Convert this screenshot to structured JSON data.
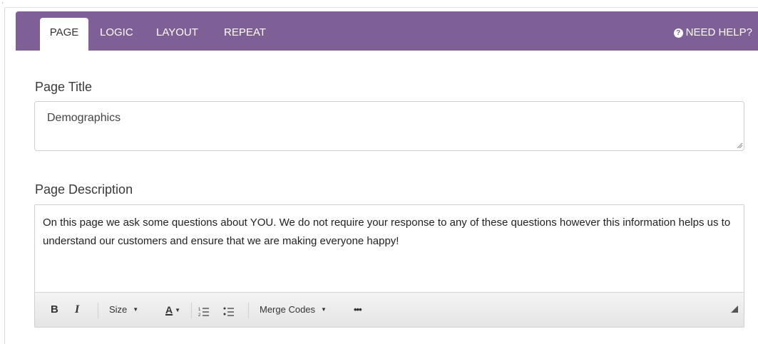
{
  "tabs": [
    {
      "label": "PAGE",
      "active": true
    },
    {
      "label": "LOGIC",
      "active": false
    },
    {
      "label": "LAYOUT",
      "active": false
    },
    {
      "label": "REPEAT",
      "active": false
    }
  ],
  "help": {
    "label": "NEED HELP?",
    "icon": "question-circle-icon"
  },
  "page_title": {
    "label": "Page Title",
    "value": "Demographics"
  },
  "page_description": {
    "label": "Page Description",
    "text": "On this page we ask some questions about YOU. We do not require your response to any of these questions however this information helps us to understand our customers and ensure that we are making everyone happy!"
  },
  "toolbar": {
    "bold": "B",
    "italic": "I",
    "size": "Size",
    "text_color": "A",
    "merge_codes": "Merge Codes",
    "more": "•••"
  },
  "colors": {
    "accent": "#7e5f96"
  }
}
